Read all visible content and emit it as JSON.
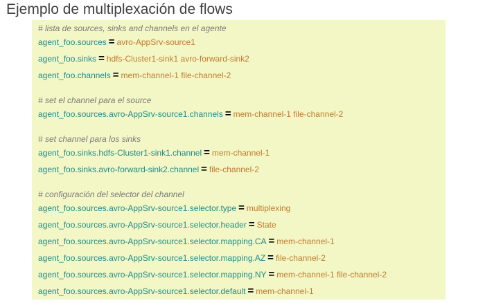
{
  "title": "Ejemplo de multiplexación de flows",
  "lines": [
    {
      "kind": "comment",
      "text": "# lista de sources, sinks and channels en el agente"
    },
    {
      "kind": "kv",
      "key": "agent_foo.sources",
      "eq": "=",
      "value": "avro-AppSrv-source1"
    },
    {
      "kind": "kv",
      "key": "agent_foo.sinks",
      "eq": "=",
      "value": "hdfs-Cluster1-sink1 avro-forward-sink2"
    },
    {
      "kind": "kv",
      "key": "agent_foo.channels",
      "eq": "=",
      "value": "mem-channel-1 file-channel-2"
    },
    {
      "kind": "comment",
      "text": "# set el channel para el source"
    },
    {
      "kind": "kv",
      "key": "agent_foo.sources.avro-AppSrv-source1.channels",
      "eq": "=",
      "value": "mem-channel-1 file-channel-2"
    },
    {
      "kind": "comment",
      "text": "# set channel para los sinks"
    },
    {
      "kind": "kv",
      "key": "agent_foo.sinks.hdfs-Cluster1-sink1.channel",
      "eq": "=",
      "value": "mem-channel-1"
    },
    {
      "kind": "kv",
      "key": "agent_foo.sinks.avro-forward-sink2.channel",
      "eq": "=",
      "value": "file-channel-2"
    },
    {
      "kind": "comment",
      "text": "# configuración del selector del channel"
    },
    {
      "kind": "kv",
      "key": "agent_foo.sources.avro-AppSrv-source1.selector.type",
      "eq": "=",
      "value": "multiplexing"
    },
    {
      "kind": "kv",
      "key": "agent_foo.sources.avro-AppSrv-source1.selector.header",
      "eq": "=",
      "value": "State"
    },
    {
      "kind": "kv",
      "key": "agent_foo.sources.avro-AppSrv-source1.selector.mapping.CA",
      "eq": "=",
      "value": "mem-channel-1"
    },
    {
      "kind": "kv",
      "key": "agent_foo.sources.avro-AppSrv-source1.selector.mapping.AZ",
      "eq": "=",
      "value": "file-channel-2"
    },
    {
      "kind": "kv",
      "key": "agent_foo.sources.avro-AppSrv-source1.selector.mapping.NY",
      "eq": "=",
      "value": "mem-channel-1 file-channel-2"
    },
    {
      "kind": "kv",
      "key": "agent_foo.sources.avro-AppSrv-source1.selector.default",
      "eq": "=",
      "value": "mem-channel-1"
    }
  ]
}
